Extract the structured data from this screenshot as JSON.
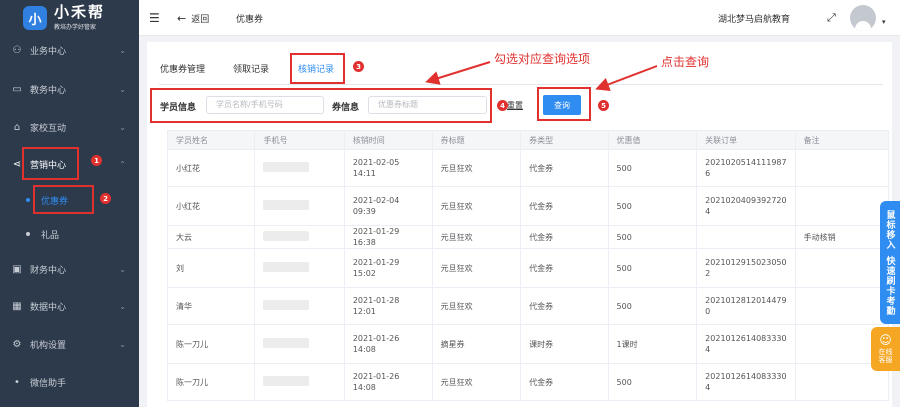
{
  "logo": {
    "mark": "小",
    "title": "小禾帮",
    "subtitle": "教培办学好管家"
  },
  "sidebar": {
    "items": [
      {
        "label": "业务中心",
        "icon": "group-icon",
        "glyph": "⚇"
      },
      {
        "label": "教务中心",
        "icon": "book-icon",
        "glyph": "▭"
      },
      {
        "label": "家校互动",
        "icon": "home-icon",
        "glyph": "⌂"
      },
      {
        "label": "营销中心",
        "icon": "share-icon",
        "glyph": "⋖"
      },
      {
        "label": "优惠券"
      },
      {
        "label": "礼品"
      },
      {
        "label": "财务中心",
        "icon": "wallet-icon",
        "glyph": "▣"
      },
      {
        "label": "数据中心",
        "icon": "chart-icon",
        "glyph": "▦"
      },
      {
        "label": "机构设置",
        "icon": "settings-icon",
        "glyph": "⚙"
      },
      {
        "label": "微信助手"
      }
    ]
  },
  "header": {
    "back": "返回",
    "page_title": "优惠券",
    "org_name": "湖北梦马启航教育"
  },
  "tabs": [
    "优惠券管理",
    "领取记录",
    "核销记录"
  ],
  "filters": {
    "student_label": "学员信息",
    "student_placeholder": "学员名称/手机号码",
    "coupon_label": "券信息",
    "coupon_placeholder": "优惠券标题",
    "reset": "重置",
    "query": "查询"
  },
  "annotations": {
    "select_tip": "勾选对应查询选项",
    "click_tip": "点击查询"
  },
  "badges": [
    "1",
    "2",
    "3",
    "4",
    "5"
  ],
  "table": {
    "columns": [
      "学员姓名",
      "手机号",
      "核销时间",
      "券标题",
      "券类型",
      "优惠值",
      "关联订单",
      "备注"
    ],
    "rows": [
      [
        "小红花",
        "",
        "2021-02-05 14:11",
        "元旦狂欢",
        "代金券",
        "500",
        "2021020514111987\n6",
        ""
      ],
      [
        "小红花",
        "",
        "2021-02-04 09:39",
        "元旦狂欢",
        "代金券",
        "500",
        "2021020409392720\n4",
        ""
      ],
      [
        "大云",
        "",
        "2021-01-29 16:38",
        "元旦狂欢",
        "代金券",
        "500",
        "",
        "手动核销"
      ],
      [
        "刘",
        "",
        "2021-01-29 15:02",
        "元旦狂欢",
        "代金券",
        "500",
        "2021012915023050\n2",
        ""
      ],
      [
        "清华",
        "",
        "2021-01-28 12:01",
        "元旦狂欢",
        "代金券",
        "500",
        "2021012812014479\n0",
        ""
      ],
      [
        "陈一刀儿",
        "",
        "2021-01-26 14:08",
        "摘星券",
        "课时券",
        "1课时",
        "2021012614083330\n4",
        ""
      ],
      [
        "陈一刀儿",
        "",
        "2021-01-26 14:08",
        "元旦狂欢",
        "代金券",
        "500",
        "2021012614083330\n4",
        ""
      ]
    ]
  },
  "float": {
    "label1": "鼠标移入",
    "label2": "快速刷卡考勤",
    "service": "在线客服"
  }
}
